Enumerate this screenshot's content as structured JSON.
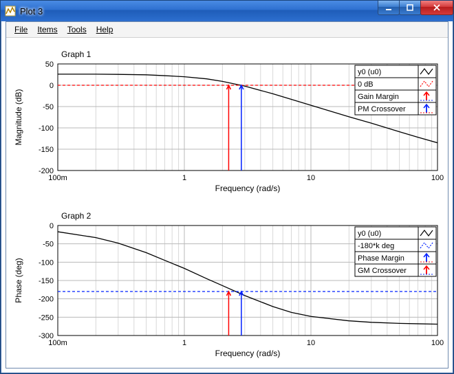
{
  "window": {
    "title": "Plot 3"
  },
  "menu": {
    "file": "File",
    "items": "Items",
    "tools": "Tools",
    "help": "Help"
  },
  "chart_data": [
    {
      "type": "line",
      "title": "Graph 1",
      "xlabel": "Frequency (rad/s)",
      "ylabel": "Magnitude (dB)",
      "xscale": "log",
      "xlim": [
        0.1,
        100
      ],
      "ylim": [
        -200,
        50
      ],
      "yticks": [
        -200,
        -150,
        -100,
        -50,
        0,
        50
      ],
      "xticks": [
        0.1,
        1,
        10,
        100
      ],
      "xtick_labels": [
        "100m",
        "1",
        "10",
        "100"
      ],
      "series": [
        {
          "name": "y0 (u0)",
          "color": "#000000",
          "style": "solid",
          "x": [
            0.1,
            0.2,
            0.3,
            0.5,
            0.7,
            1,
            1.5,
            2,
            3,
            5,
            7,
            10,
            20,
            30,
            50,
            70,
            100
          ],
          "y": [
            26,
            26,
            25.5,
            24.5,
            22.5,
            20,
            15,
            9,
            -2,
            -20,
            -33,
            -47,
            -74,
            -89,
            -109,
            -122,
            -135
          ]
        },
        {
          "name": "0 dB",
          "color": "#ff0000",
          "style": "dashed",
          "x": [
            0.1,
            100
          ],
          "y": [
            0,
            0
          ]
        }
      ],
      "markers": [
        {
          "name": "Gain Margin",
          "color": "#ff0000",
          "x": 2.24,
          "y0": -200,
          "y1": 0
        },
        {
          "name": "PM Crossover",
          "color": "#0020ff",
          "x": 2.82,
          "y0": -200,
          "y1": 0
        }
      ],
      "legend": [
        "y0 (u0)",
        "0 dB",
        "Gain Margin",
        "PM Crossover"
      ]
    },
    {
      "type": "line",
      "title": "Graph 2",
      "xlabel": "Frequency (rad/s)",
      "ylabel": "Phase (deg)",
      "xscale": "log",
      "xlim": [
        0.1,
        100
      ],
      "ylim": [
        -300,
        0
      ],
      "yticks": [
        -300,
        -250,
        -200,
        -150,
        -100,
        -50,
        0
      ],
      "xticks": [
        0.1,
        1,
        10,
        100
      ],
      "xtick_labels": [
        "100m",
        "1",
        "10",
        "100"
      ],
      "series": [
        {
          "name": "y0 (u0)",
          "color": "#000000",
          "style": "solid",
          "x": [
            0.1,
            0.2,
            0.3,
            0.5,
            0.7,
            1,
            1.5,
            2,
            3,
            5,
            7,
            10,
            20,
            30,
            50,
            70,
            100
          ],
          "y": [
            -17,
            -33,
            -48,
            -74,
            -95,
            -117,
            -145,
            -164,
            -191,
            -221,
            -237,
            -248,
            -260,
            -264,
            -267,
            -268,
            -269
          ]
        },
        {
          "name": "-180*k deg",
          "color": "#0020ff",
          "style": "dashed",
          "x": [
            0.1,
            100
          ],
          "y": [
            -180,
            -180
          ]
        }
      ],
      "markers": [
        {
          "name": "Phase Margin",
          "color": "#0020ff",
          "x": 2.82,
          "y0": -300,
          "y1": -180
        },
        {
          "name": "GM Crossover",
          "color": "#ff0000",
          "x": 2.24,
          "y0": -300,
          "y1": -180
        }
      ],
      "legend": [
        "y0 (u0)",
        "-180*k deg",
        "Phase Margin",
        "GM Crossover"
      ]
    }
  ],
  "legend_labels": {
    "g1_0": "y0 (u0)",
    "g1_1": "0 dB",
    "g1_2": "Gain Margin",
    "g1_3": "PM Crossover",
    "g2_0": "y0 (u0)",
    "g2_1": "-180*k deg",
    "g2_2": "Phase Margin",
    "g2_3": "GM Crossover"
  }
}
